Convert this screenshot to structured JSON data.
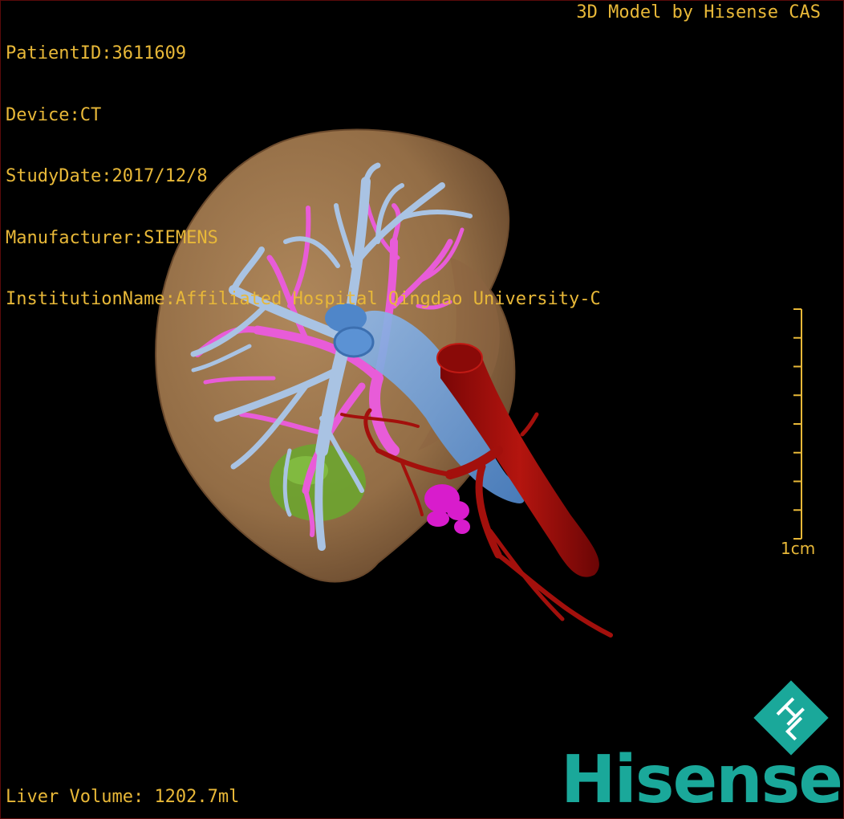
{
  "header": {
    "patient_id": "PatientID:3611609",
    "device": "Device:CT",
    "study_date": "StudyDate:2017/12/8",
    "manufacturer": "Manufacturer:SIEMENS",
    "institution": "InstitutionName:Affiliated Hospital Qingdao University-C"
  },
  "watermark": "3D Model by Hisense CAS",
  "footer": {
    "volume": "Liver Volume: 1202.7ml"
  },
  "scale_bar": {
    "label": "1cm",
    "tick_count": 9
  },
  "logo": {
    "text": "Hisense",
    "mark_letters": "HL"
  },
  "colors": {
    "text": "#e8b838",
    "liver": "#b5895a",
    "hepatic_vein": "#a9c3e3",
    "portal_vein": "#e85cd8",
    "vena_cava": "#6fa3dd",
    "artery": "#a3100c",
    "gallbladder": "#6aa82e",
    "brand": "#1aa89a"
  }
}
